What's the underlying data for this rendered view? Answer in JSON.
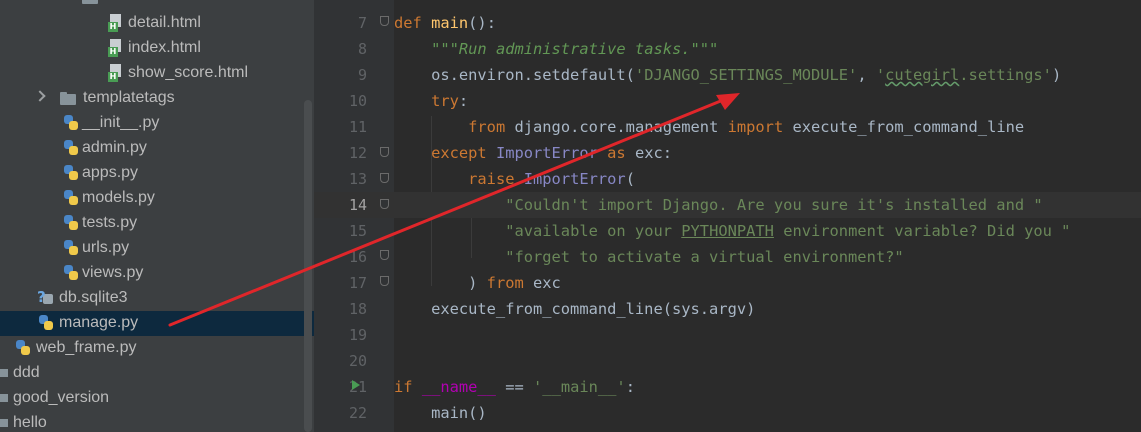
{
  "tree": [
    {
      "kind": "html",
      "label": "detail.html"
    },
    {
      "kind": "html",
      "label": "index.html"
    },
    {
      "kind": "html",
      "label": "show_score.html"
    },
    {
      "kind": "folder",
      "label": "templatetags"
    },
    {
      "kind": "py",
      "label": "__init__.py"
    },
    {
      "kind": "py",
      "label": "admin.py"
    },
    {
      "kind": "py",
      "label": "apps.py"
    },
    {
      "kind": "py",
      "label": "models.py"
    },
    {
      "kind": "py",
      "label": "tests.py"
    },
    {
      "kind": "py",
      "label": "urls.py"
    },
    {
      "kind": "py",
      "label": "views.py"
    },
    {
      "kind": "db",
      "label": "db.sqlite3"
    },
    {
      "kind": "py",
      "label": "manage.py",
      "selected": true
    },
    {
      "kind": "py",
      "label": "web_frame.py"
    },
    {
      "kind": "folder",
      "label": "ddd"
    },
    {
      "kind": "folder",
      "label": "good_version"
    },
    {
      "kind": "folder",
      "label": "hello"
    }
  ],
  "gutter": {
    "lines": [
      "7",
      "8",
      "9",
      "10",
      "11",
      "12",
      "13",
      "14",
      "15",
      "16",
      "17",
      "18",
      "19",
      "20",
      "21",
      "22"
    ],
    "current_line": "14"
  },
  "code": [
    {
      "no": "7",
      "tokens": [
        {
          "t": "def ",
          "c": "kw"
        },
        {
          "t": "main",
          "c": "fn"
        },
        {
          "t": "():",
          "c": ""
        }
      ]
    },
    {
      "no": "8",
      "tokens": [
        {
          "t": "    ",
          "c": ""
        },
        {
          "t": "\"\"\"Run administrative tasks.\"\"\"",
          "c": "doc"
        }
      ]
    },
    {
      "no": "9",
      "tokens": [
        {
          "t": "    os.environ.setdefault(",
          "c": ""
        },
        {
          "t": "'DJANGO_SETTINGS_MODULE'",
          "c": "str"
        },
        {
          "t": ", ",
          "c": ""
        },
        {
          "t": "'",
          "c": "str"
        },
        {
          "t": "cutegirl",
          "c": "str typo"
        },
        {
          "t": ".settings'",
          "c": "str"
        },
        {
          "t": ")",
          "c": ""
        }
      ]
    },
    {
      "no": "10",
      "tokens": [
        {
          "t": "    ",
          "c": ""
        },
        {
          "t": "try",
          "c": "kw"
        },
        {
          "t": ":",
          "c": ""
        }
      ]
    },
    {
      "no": "11",
      "tokens": [
        {
          "t": "        ",
          "c": ""
        },
        {
          "t": "from ",
          "c": "kw"
        },
        {
          "t": "django.core.management ",
          "c": ""
        },
        {
          "t": "import ",
          "c": "kw"
        },
        {
          "t": "execute_from_command_line",
          "c": ""
        }
      ]
    },
    {
      "no": "12",
      "tokens": [
        {
          "t": "    ",
          "c": ""
        },
        {
          "t": "except ",
          "c": "kw"
        },
        {
          "t": "ImportError ",
          "c": "cls"
        },
        {
          "t": "as ",
          "c": "kw"
        },
        {
          "t": "exc:",
          "c": ""
        }
      ]
    },
    {
      "no": "13",
      "tokens": [
        {
          "t": "        ",
          "c": ""
        },
        {
          "t": "raise ",
          "c": "kw"
        },
        {
          "t": "ImportError",
          "c": "cls"
        },
        {
          "t": "(",
          "c": ""
        }
      ]
    },
    {
      "no": "14",
      "tokens": [
        {
          "t": "            ",
          "c": ""
        },
        {
          "t": "\"Couldn't import Django. Are you sure it's installed and \"",
          "c": "str"
        }
      ]
    },
    {
      "no": "15",
      "tokens": [
        {
          "t": "            ",
          "c": ""
        },
        {
          "t": "\"available on your ",
          "c": "str"
        },
        {
          "t": "PYTHONPATH",
          "c": "str ul"
        },
        {
          "t": " environment variable? Did you \"",
          "c": "str"
        }
      ]
    },
    {
      "no": "16",
      "tokens": [
        {
          "t": "            ",
          "c": ""
        },
        {
          "t": "\"forget to activate a virtual environment?\"",
          "c": "str"
        }
      ]
    },
    {
      "no": "17",
      "tokens": [
        {
          "t": "        ) ",
          "c": ""
        },
        {
          "t": "from ",
          "c": "kw"
        },
        {
          "t": "exc",
          "c": ""
        }
      ]
    },
    {
      "no": "18",
      "tokens": [
        {
          "t": "    execute_from_command_line(sys.argv)",
          "c": ""
        }
      ]
    },
    {
      "no": "19",
      "tokens": []
    },
    {
      "no": "20",
      "tokens": []
    },
    {
      "no": "21",
      "tokens": [
        {
          "t": "if ",
          "c": "kw"
        },
        {
          "t": "__name__",
          "c": "dunder"
        },
        {
          "t": " == ",
          "c": ""
        },
        {
          "t": "'__main__'",
          "c": "str"
        },
        {
          "t": ":",
          "c": ""
        }
      ]
    },
    {
      "no": "22",
      "tokens": [
        {
          "t": "    main()",
          "c": ""
        }
      ]
    }
  ],
  "colors": {
    "annotation_arrow": "#e0262a",
    "editor_bg": "#2b2b2b",
    "tree_bg": "#3c3f41",
    "selection_bg": "#0d293e"
  },
  "icons": {
    "html": "html-file-icon",
    "py": "python-file-icon",
    "folder": "folder-icon",
    "db": "database-file-icon"
  }
}
